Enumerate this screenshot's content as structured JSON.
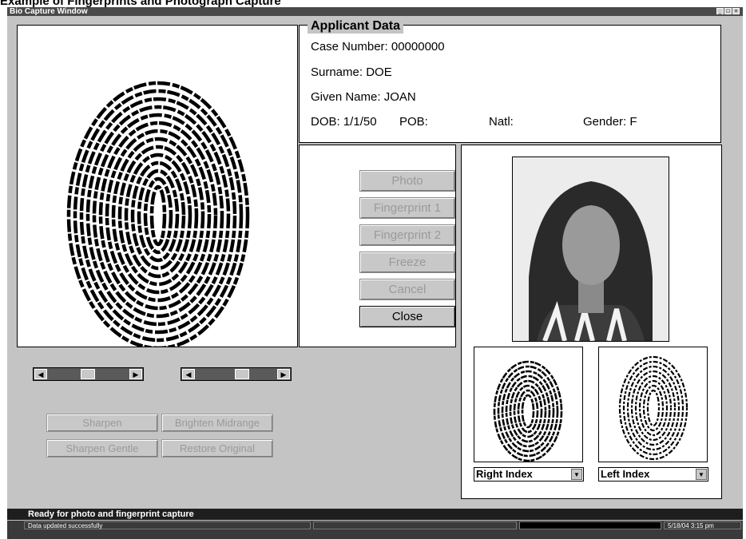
{
  "caption": "Example of Fingerprints and Photograph Capture",
  "window": {
    "title": "Bio Capture Window",
    "controls": [
      "_",
      "□",
      "×"
    ]
  },
  "applicant": {
    "legend": "Applicant Data",
    "case_number": "Case Number: 00000000",
    "surname": "Surname: DOE",
    "given_name": "Given Name: JOAN",
    "dob": "DOB: 1/1/50",
    "pob": "POB:",
    "natl": "Natl:",
    "gender": "Gender: F"
  },
  "capture_buttons": {
    "photo": "Photo",
    "fingerprint1": "Fingerprint 1",
    "fingerprint2": "Fingerprint 2",
    "freeze": "Freeze",
    "cancel": "Cancel",
    "close": "Close"
  },
  "image_buttons": {
    "sharpen": "Sharpen",
    "brighten_midrange": "Brighten Midrange",
    "sharpen_gentle": "Sharpen Gentle",
    "restore_original": "Restore Original"
  },
  "sliders": {
    "left_level": 0.48,
    "right_level": 0.58
  },
  "finger_selects": {
    "right": "Right Index",
    "left": "Left Index"
  },
  "status": {
    "message": "Ready for photo and fingerprint capture",
    "bar_left": "Data updated successfully",
    "bar_right": "5/18/04   3:15 pm"
  },
  "icons": {
    "slider_left": "triangle-left-icon",
    "slider_right": "triangle-right-icon",
    "dropdown": "triangle-down-icon"
  }
}
